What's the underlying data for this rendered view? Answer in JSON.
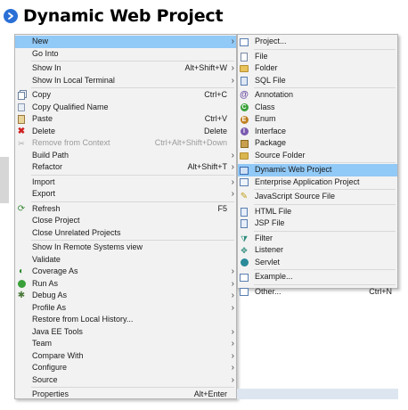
{
  "heading": {
    "title": "Dynamic Web Project",
    "bullet_color": "#2a6fd6"
  },
  "main_menu": {
    "groups": [
      [
        {
          "label": "New",
          "shortcut": "",
          "submenu": true,
          "highlighted": true
        },
        {
          "label": "Go Into",
          "shortcut": "",
          "submenu": false
        }
      ],
      [
        {
          "label": "Show In",
          "shortcut": "Alt+Shift+W",
          "submenu": true
        },
        {
          "label": "Show In Local Terminal",
          "shortcut": "",
          "submenu": true
        }
      ],
      [
        {
          "label": "Copy",
          "shortcut": "Ctrl+C",
          "submenu": false,
          "icon": "copy-icon"
        },
        {
          "label": "Copy Qualified Name",
          "shortcut": "",
          "submenu": false,
          "icon": "copy-qualified-icon"
        },
        {
          "label": "Paste",
          "shortcut": "Ctrl+V",
          "submenu": false,
          "icon": "paste-icon"
        },
        {
          "label": "Delete",
          "shortcut": "Delete",
          "submenu": false,
          "icon": "delete-icon"
        },
        {
          "label": "Remove from Context",
          "shortcut": "Ctrl+Alt+Shift+Down",
          "submenu": false,
          "icon": "remove-context-icon",
          "disabled": true
        },
        {
          "label": "Build Path",
          "shortcut": "",
          "submenu": true
        },
        {
          "label": "Refactor",
          "shortcut": "Alt+Shift+T",
          "submenu": true
        }
      ],
      [
        {
          "label": "Import",
          "shortcut": "",
          "submenu": true
        },
        {
          "label": "Export",
          "shortcut": "",
          "submenu": true
        }
      ],
      [
        {
          "label": "Refresh",
          "shortcut": "F5",
          "submenu": false,
          "icon": "refresh-icon"
        },
        {
          "label": "Close Project",
          "shortcut": "",
          "submenu": false
        },
        {
          "label": "Close Unrelated Projects",
          "shortcut": "",
          "submenu": false
        }
      ],
      [
        {
          "label": "Show In Remote Systems view",
          "shortcut": "",
          "submenu": false
        },
        {
          "label": "Validate",
          "shortcut": "",
          "submenu": false
        },
        {
          "label": "Coverage As",
          "shortcut": "",
          "submenu": true,
          "icon": "coverage-icon"
        },
        {
          "label": "Run As",
          "shortcut": "",
          "submenu": true,
          "icon": "run-icon"
        },
        {
          "label": "Debug As",
          "shortcut": "",
          "submenu": true,
          "icon": "debug-icon"
        },
        {
          "label": "Profile As",
          "shortcut": "",
          "submenu": true
        },
        {
          "label": "Restore from Local History...",
          "shortcut": "",
          "submenu": false
        },
        {
          "label": "Java EE Tools",
          "shortcut": "",
          "submenu": true
        },
        {
          "label": "Team",
          "shortcut": "",
          "submenu": true
        },
        {
          "label": "Compare With",
          "shortcut": "",
          "submenu": true
        },
        {
          "label": "Configure",
          "shortcut": "",
          "submenu": true
        },
        {
          "label": "Source",
          "shortcut": "",
          "submenu": true
        }
      ],
      [
        {
          "label": "Properties",
          "shortcut": "Alt+Enter",
          "submenu": false
        }
      ]
    ]
  },
  "sub_menu": {
    "groups": [
      [
        {
          "label": "Project...",
          "shortcut": "",
          "icon": "project-icon"
        }
      ],
      [
        {
          "label": "File",
          "shortcut": "",
          "icon": "file-icon"
        },
        {
          "label": "Folder",
          "shortcut": "",
          "icon": "folder-icon"
        },
        {
          "label": "SQL File",
          "shortcut": "",
          "icon": "sql-file-icon"
        }
      ],
      [
        {
          "label": "Annotation",
          "shortcut": "",
          "icon": "annotation-icon"
        },
        {
          "label": "Class",
          "shortcut": "",
          "icon": "class-icon"
        },
        {
          "label": "Enum",
          "shortcut": "",
          "icon": "enum-icon"
        },
        {
          "label": "Interface",
          "shortcut": "",
          "icon": "interface-icon"
        },
        {
          "label": "Package",
          "shortcut": "",
          "icon": "package-icon"
        },
        {
          "label": "Source Folder",
          "shortcut": "",
          "icon": "source-folder-icon"
        }
      ],
      [
        {
          "label": "Dynamic Web Project",
          "shortcut": "",
          "icon": "dynamic-web-project-icon",
          "highlighted": true
        },
        {
          "label": "Enterprise Application Project",
          "shortcut": "",
          "icon": "enterprise-app-icon"
        }
      ],
      [
        {
          "label": "JavaScript Source File",
          "shortcut": "",
          "icon": "javascript-file-icon"
        }
      ],
      [
        {
          "label": "HTML File",
          "shortcut": "",
          "icon": "html-file-icon"
        },
        {
          "label": "JSP File",
          "shortcut": "",
          "icon": "jsp-file-icon"
        }
      ],
      [
        {
          "label": "Filter",
          "shortcut": "",
          "icon": "filter-icon"
        },
        {
          "label": "Listener",
          "shortcut": "",
          "icon": "listener-icon"
        },
        {
          "label": "Servlet",
          "shortcut": "",
          "icon": "servlet-icon"
        }
      ],
      [
        {
          "label": "Example...",
          "shortcut": "",
          "icon": "example-icon"
        }
      ],
      [
        {
          "label": "Other...",
          "shortcut": "Ctrl+N",
          "icon": "other-icon"
        }
      ]
    ]
  },
  "colors": {
    "menu_bg": "#f2f2f2",
    "highlight": "#91c9f7",
    "text": "#1a1a1a",
    "disabled_text": "#9a9a9a"
  }
}
